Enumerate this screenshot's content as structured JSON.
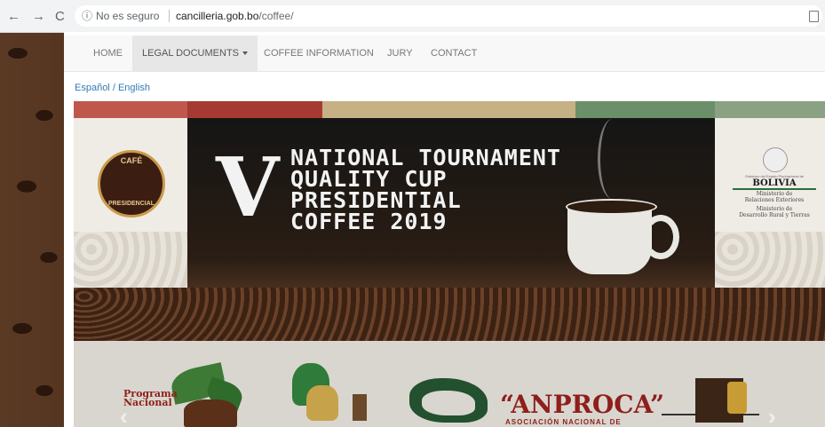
{
  "browser": {
    "back_icon": "arrow-left-icon",
    "forward_icon": "arrow-right-icon",
    "reload_icon": "reload-icon",
    "security_text": "No es seguro",
    "url_domain": "cancilleria.gob.bo",
    "url_path": "/coffee/"
  },
  "navbar": {
    "items": [
      {
        "label": "HOME"
      },
      {
        "label": "LEGAL DOCUMENTS"
      },
      {
        "label": "COFFEE INFORMATION"
      },
      {
        "label": "JURY"
      },
      {
        "label": "CONTACT"
      }
    ]
  },
  "language": {
    "spanish": "Español",
    "separator": " / ",
    "english": "English"
  },
  "banner": {
    "numeral": "V",
    "title_lines": [
      "NATIONAL TOURNAMENT",
      "QUALITY CUP",
      "PRESIDENTIAL",
      "COFFEE 2019"
    ],
    "logo_left_top": "CAFÉ",
    "logo_left_bottom": "PRESIDENCIAL",
    "gov_small": "Gobierno del Estado Plurinacional de",
    "gov_big": "BOLIVIA",
    "ministry1": [
      "Ministerio de",
      "Relaciones Exteriores"
    ],
    "ministry2": [
      "Ministerio de",
      "Desarrollo Rural y Tierras"
    ],
    "programa": [
      "Programa",
      "Nacional"
    ],
    "anproca": "“ANPROCA”",
    "anproca_sub": "ASOCIACIÓN NACIONAL DE"
  },
  "colors": {
    "stripe_red": "#c0574d",
    "stripe_darkred": "#a63a33",
    "stripe_tan": "#c6b184",
    "stripe_green": "#6b8f68",
    "link": "#337ab7"
  }
}
